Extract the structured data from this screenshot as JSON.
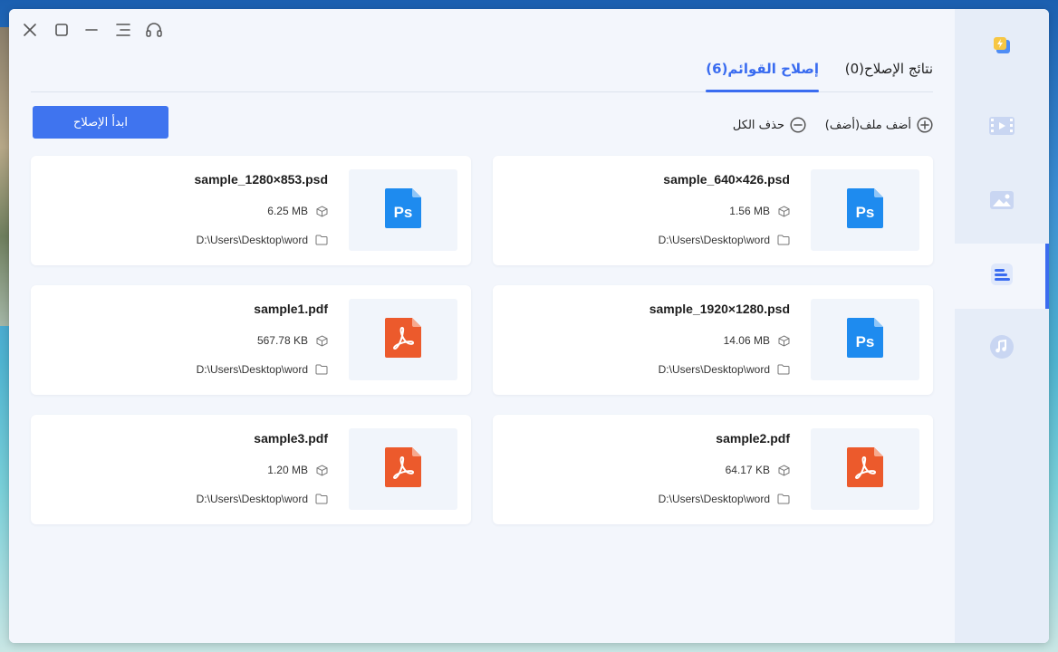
{
  "window_controls": {
    "close_icon": "close-icon",
    "maximize_icon": "maximize-icon",
    "minimize_icon": "minimize-icon",
    "menu_icon": "menu-icon",
    "support_icon": "headset-icon"
  },
  "tabs": [
    {
      "label": "نتائج الإصلاح(0)",
      "active": false
    },
    {
      "label": "إصلاح القوائم(6)",
      "active": true
    }
  ],
  "toolbar": {
    "start_label": "ابدأ الإصلاح",
    "add_label": "أضف ملف(أضف)",
    "clear_label": "حذف الكل"
  },
  "files": [
    {
      "name": "sample_640×426.psd",
      "size": "1.56 MB",
      "path": "D:\\Users\\Desktop\\word",
      "type": "psd"
    },
    {
      "name": "sample_1280×853.psd",
      "size": "6.25 MB",
      "path": "D:\\Users\\Desktop\\word",
      "type": "psd"
    },
    {
      "name": "sample_1920×1280.psd",
      "size": "14.06 MB",
      "path": "D:\\Users\\Desktop\\word",
      "type": "psd"
    },
    {
      "name": "sample1.pdf",
      "size": "567.78 KB",
      "path": "D:\\Users\\Desktop\\word",
      "type": "pdf"
    },
    {
      "name": "sample2.pdf",
      "size": "64.17 KB",
      "path": "D:\\Users\\Desktop\\word",
      "type": "pdf"
    },
    {
      "name": "sample3.pdf",
      "size": "1.20 MB",
      "path": "D:\\Users\\Desktop\\word",
      "type": "pdf"
    }
  ],
  "sidebar": [
    {
      "icon": "repair-tool-icon",
      "active": false
    },
    {
      "icon": "video-icon",
      "active": false
    },
    {
      "icon": "image-icon",
      "active": false
    },
    {
      "icon": "document-icon",
      "active": true
    },
    {
      "icon": "music-icon",
      "active": false
    }
  ],
  "colors": {
    "accent": "#3a6cf0",
    "psd": "#1f8ff0",
    "pdf": "#ec5a2c"
  }
}
